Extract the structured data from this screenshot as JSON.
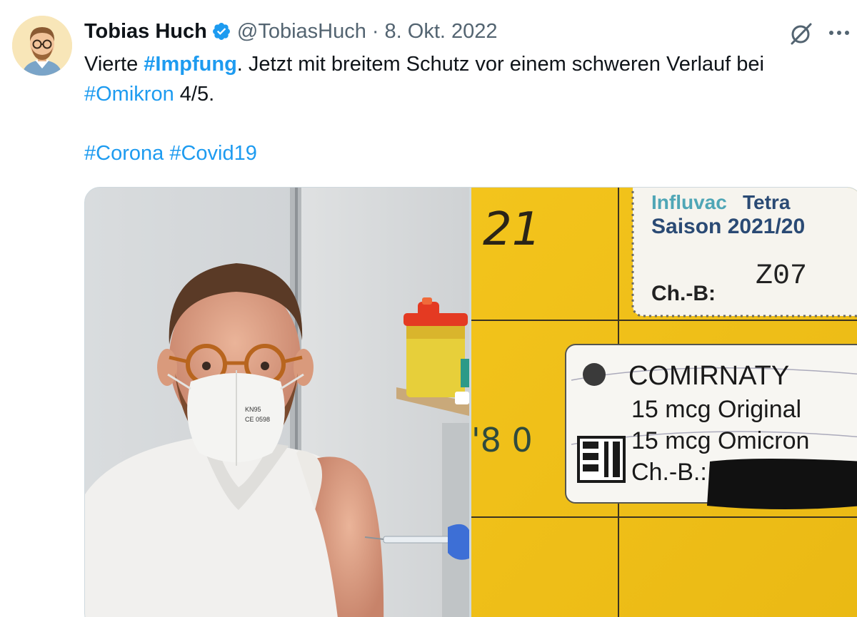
{
  "tweet": {
    "author": {
      "name": "Tobias Huch",
      "handle": "@TobiasHuch",
      "verified": true,
      "avatar_icon": "cartoon-avatar-icon"
    },
    "separator": "·",
    "date": "8. Okt. 2022",
    "icons": [
      "verified-badge-icon",
      "grok-icon",
      "more-icon"
    ],
    "text": {
      "line1_prefix": "Vierte ",
      "line1_hashtag": "#Impfung",
      "line1_suffix": ". Jetzt mit breitem Schutz vor einem schweren Verlauf bei",
      "line2_hashtag": "#Omikron",
      "line2_suffix": " 4/5.",
      "line4_hashtag1": "#Corona",
      "line4_hashtag2": "#Covid19"
    },
    "media": {
      "left_photo": {
        "mask_text": [
          "KN95",
          "CE 0598"
        ]
      },
      "right_photo": {
        "handwritten_top": "21",
        "handwritten_side": "'8 0",
        "label1": {
          "brand": "Influvac",
          "brand_suffix": "Tetra",
          "season": "Saison 2021/20",
          "batch_label": "Ch.-B:",
          "batch_value": "Z07"
        },
        "label2": {
          "brand": "COMIRNATY",
          "line1": "15 mcg Original",
          "line2": "15 mcg Omicron",
          "batch_label": "Ch.-B.:"
        }
      }
    },
    "colors": {
      "text": "#0f1419",
      "secondary": "#536471",
      "accent": "#1d9bf0",
      "card_yellow": "#f2c21c"
    }
  }
}
